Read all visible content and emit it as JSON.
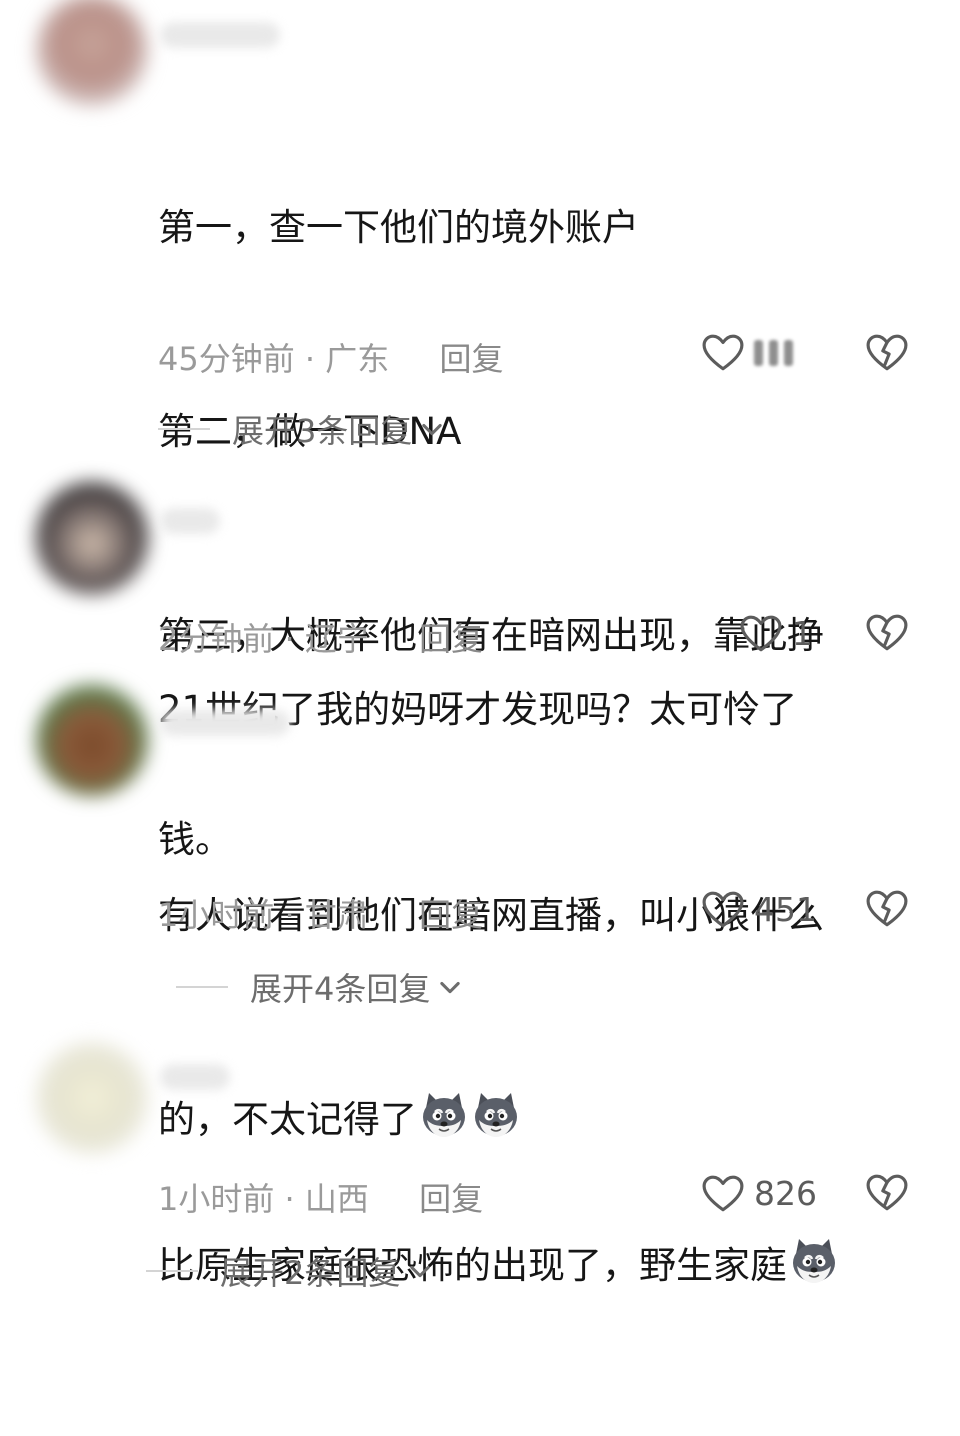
{
  "comments": [
    {
      "lines": [
        "第一，查一下他们的境外账户",
        "第二，做一下DNA",
        "第三，大概率他们有在暗网出现，靠此挣",
        "钱。"
      ],
      "time": "45分钟前",
      "location": "广东",
      "reply_label": "回复",
      "likes": "",
      "expand_label": "展开3条回复"
    },
    {
      "lines": [
        "21世纪了我的妈呀才发现吗？太可怜了"
      ],
      "time": "2分钟前",
      "location": "辽宁",
      "reply_label": "回复",
      "likes": "1"
    },
    {
      "lines": [
        "有人说看到他们在暗网直播，叫小猿什么",
        "的，不太记得了"
      ],
      "time": "1小时前",
      "location": "甘肃",
      "reply_label": "回复",
      "likes": "451",
      "expand_label": "展开4条回复"
    },
    {
      "lines": [
        "比原生家庭很恐怖的出现了，野生家庭"
      ],
      "time": "1小时前",
      "location": "山西",
      "reply_label": "回复",
      "likes": "826",
      "expand_label": "展开2条回复"
    }
  ],
  "meta_separator": "·",
  "icons": {
    "like": "heart-outline-icon",
    "dislike": "broken-heart-icon",
    "expand": "chevron-down-icon",
    "emoji": "husky-dog-emoji-icon"
  },
  "colors": {
    "text": "#161616",
    "meta": "#9a9a9a",
    "icon": "#5c5c5c"
  }
}
